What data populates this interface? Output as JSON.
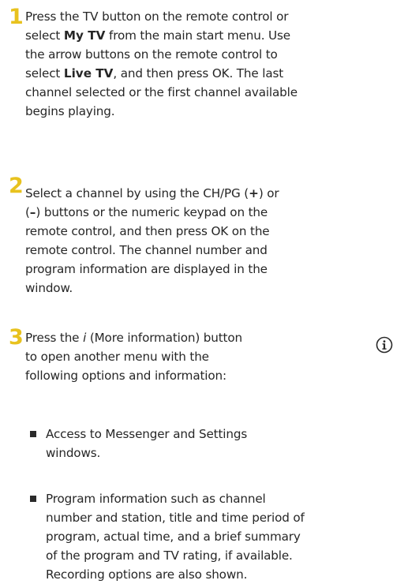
{
  "steps": [
    {
      "number": "1",
      "lines": [
        [
          {
            "t": "Press the TV button on the remote control or"
          }
        ],
        [
          {
            "t": "select "
          },
          {
            "t": "My TV",
            "b": true
          },
          {
            "t": " from the main start menu. Use"
          }
        ],
        [
          {
            "t": "the arrow buttons on the remote control to"
          }
        ],
        [
          {
            "t": "select "
          },
          {
            "t": "Live TV",
            "b": true
          },
          {
            "t": ", and then press OK. The last"
          }
        ],
        [
          {
            "t": "channel selected or the first channel available"
          }
        ],
        [
          {
            "t": "begins playing."
          }
        ]
      ]
    },
    {
      "number": "2",
      "lines": [
        [
          {
            "t": "Select a channel by using the CH/PG ("
          },
          {
            "t": "+",
            "b": true
          },
          {
            "t": ") or"
          }
        ],
        [
          {
            "t": "("
          },
          {
            "t": "–",
            "b": true
          },
          {
            "t": ") buttons or the numeric keypad on the"
          }
        ],
        [
          {
            "t": "remote control, and then press OK on the"
          }
        ],
        [
          {
            "t": "remote control. The channel number and"
          }
        ],
        [
          {
            "t": "program information are displayed in the"
          }
        ],
        [
          {
            "t": "window."
          }
        ]
      ]
    },
    {
      "number": "3",
      "lines": [
        [
          {
            "t": "Press the "
          },
          {
            "t": "i",
            "i": true
          },
          {
            "t": " (More information) button"
          }
        ],
        [
          {
            "t": "to open another menu with the"
          }
        ],
        [
          {
            "t": "following options and information:"
          }
        ]
      ]
    }
  ],
  "bullets": [
    {
      "lines": [
        "Access to Messenger and Settings",
        "windows."
      ]
    },
    {
      "lines": [
        "Program information such as channel",
        "number and station, title and time period of",
        "program, actual time, and a brief summary",
        "of the program and TV rating, if available.",
        "Recording options are also shown."
      ]
    }
  ],
  "colors": {
    "step_number": "#e8c21e",
    "text": "#262626",
    "bullet": "#2a2a2a"
  },
  "icons": {
    "more_info": "info-circle-icon"
  }
}
